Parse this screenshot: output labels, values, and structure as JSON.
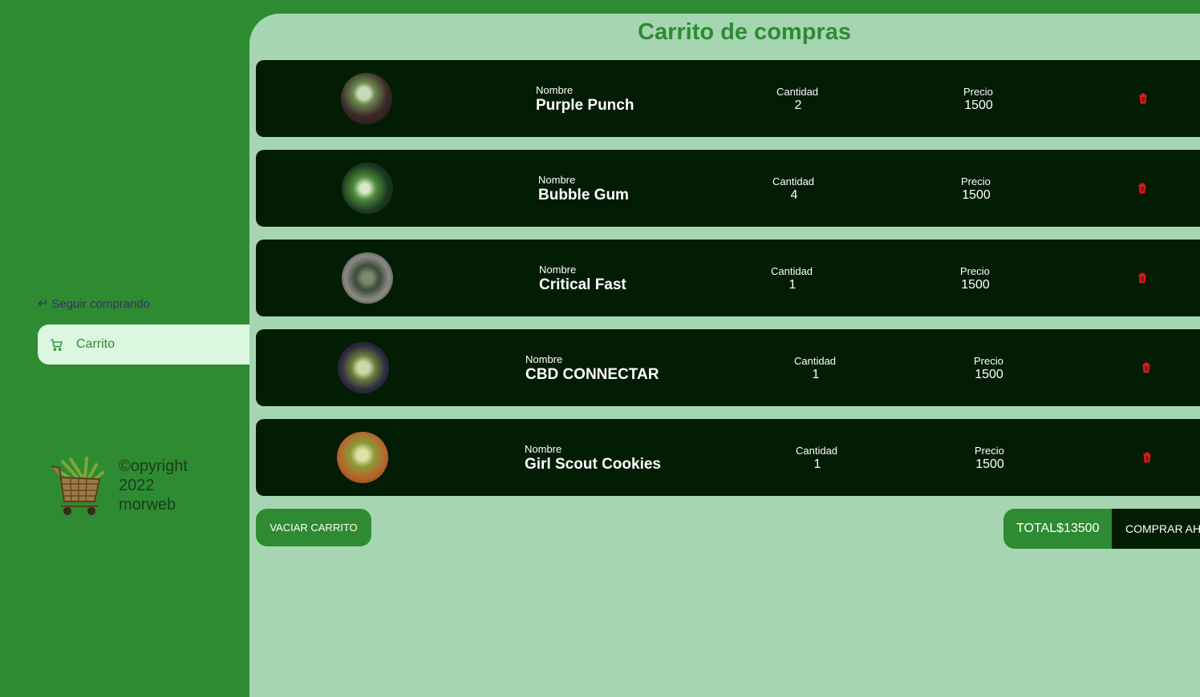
{
  "sidebar": {
    "back_label": "Seguir comprando",
    "nav_cart_label": "Carrito",
    "footer_lines": [
      "©opyright",
      "2022",
      "morweb"
    ]
  },
  "main": {
    "title": "Carrito de compras",
    "labels": {
      "name": "Nombre",
      "qty": "Cantidad",
      "price": "Precio"
    },
    "items": [
      {
        "name": "Purple Punch",
        "qty": "2",
        "price": "1500"
      },
      {
        "name": "Bubble Gum",
        "qty": "4",
        "price": "1500"
      },
      {
        "name": "Critical Fast",
        "qty": "1",
        "price": "1500"
      },
      {
        "name": "CBD CONNECTAR",
        "qty": "1",
        "price": "1500"
      },
      {
        "name": "Girl Scout Cookies",
        "qty": "1",
        "price": "1500"
      }
    ],
    "empty_button": "VACIAR CARRITO",
    "total_label": "TOTAL$13500",
    "buy_button": "COMPRAR AHORA"
  },
  "colors": {
    "sidebar": "#2e8b32",
    "content": "#a5d6b1",
    "item_bg": "#031c04",
    "trash": "#e01919",
    "active_nav": "#dbf7e0"
  },
  "icons": [
    "return-arrow-icon",
    "cart-icon",
    "trash-icon"
  ]
}
